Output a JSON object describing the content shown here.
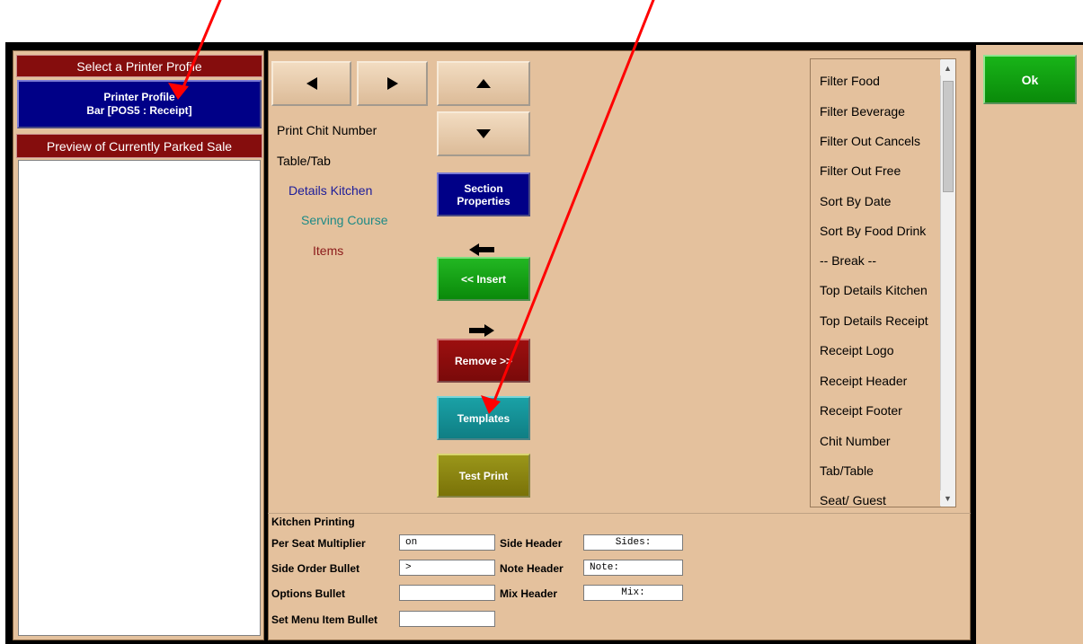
{
  "left": {
    "select_profile_header": "Select a Printer Profile",
    "profile_button": {
      "line1": "Printer Profile",
      "line2": "Bar [POS5 : Receipt]"
    },
    "preview_header": "Preview of Currently Parked Sale"
  },
  "center": {
    "tree": [
      "Print Chit Number",
      "Table/Tab",
      "Details Kitchen",
      "Serving Course",
      "Items"
    ],
    "buttons": {
      "section_properties": "Section Properties",
      "insert": "<< Insert",
      "remove": "Remove >>",
      "templates": "Templates",
      "test_print": "Test Print"
    },
    "list": [
      "Filter Food",
      "Filter Beverage",
      "Filter Out Cancels",
      "Filter Out Free",
      "Sort By Date",
      "Sort By Food Drink",
      "-- Break --",
      "Top Details Kitchen",
      "Top Details Receipt",
      "Receipt Logo",
      "Receipt Header",
      "Receipt Footer",
      "Chit Number",
      "Tab/Table",
      "Seat/ Guest"
    ]
  },
  "kitchen_printing": {
    "legend": "Kitchen Printing",
    "per_seat_multiplier": {
      "label": "Per Seat Multiplier",
      "value": "on"
    },
    "side_order_bullet": {
      "label": "Side Order Bullet",
      "value": ">"
    },
    "options_bullet": {
      "label": "Options Bullet",
      "value": ""
    },
    "set_menu_item_bullet": {
      "label": "Set Menu Item Bullet",
      "value": ""
    },
    "side_header": {
      "label": "Side Header",
      "value": "Sides:"
    },
    "note_header": {
      "label": "Note Header",
      "value": "Note:"
    },
    "mix_header": {
      "label": "Mix Header",
      "value": "Mix:"
    }
  },
  "right": {
    "ok": "Ok"
  },
  "colors": {
    "panel_bg": "#e4c19d",
    "header_red": "#850d0d",
    "profile_blue": "#000087",
    "tree_blue": "#1c1c9a",
    "tree_teal": "#1e8a86",
    "tree_maroon": "#8b1a1a",
    "annotation_red": "#ff0000"
  },
  "icons": {
    "nav_left": "left-triangle-icon",
    "nav_right": "right-triangle-icon",
    "nav_up": "up-triangle-icon",
    "nav_down": "down-triangle-icon",
    "insert_arrow": "left-arrow-icon",
    "remove_arrow": "right-arrow-icon"
  }
}
